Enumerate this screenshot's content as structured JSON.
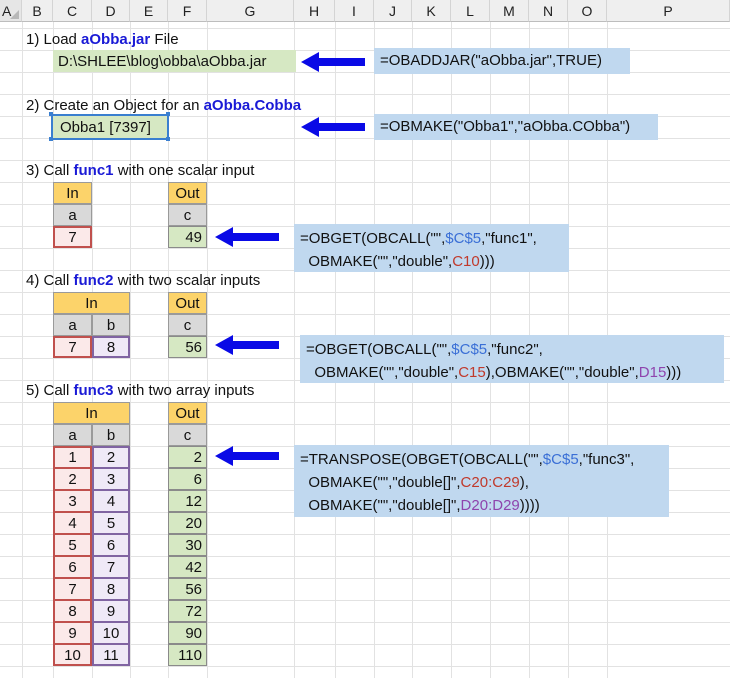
{
  "columns": [
    "A",
    "B",
    "C",
    "D",
    "E",
    "F",
    "G",
    "H",
    "I",
    "J",
    "K",
    "L",
    "M",
    "N",
    "O",
    "P"
  ],
  "colors": {
    "arrow": "#0a0ae6",
    "formula_bg": "#c0d8ef",
    "header_fill": "#fcd36a",
    "output_fill": "#d6e8c3"
  },
  "step1": {
    "label_pre": "1) Load ",
    "label_em": "aObba.jar",
    "label_post": " File",
    "path": "D:\\SHLEE\\blog\\obba\\aObba.jar",
    "formula": "=OBADDJAR(\"aObba.jar\",TRUE)"
  },
  "step2": {
    "label_pre": "2) Create an Object for an ",
    "label_em": "aObba.Cobba",
    "object": "Obba1 [7397]",
    "formula": "=OBMAKE(\"Obba1\",\"aObba.CObba\")"
  },
  "step3": {
    "label_pre": "3) Call ",
    "label_em": "func1",
    "label_post": " with one scalar input",
    "in_header": "In",
    "in_sub": "a",
    "in_value": "7",
    "out_header": "Out",
    "out_sub": "c",
    "out_value": "49",
    "formula_l1_a": "=OBGET(OBCALL(\"\",",
    "formula_l1_ref": "$C$5",
    "formula_l1_b": ",\"func1\",",
    "formula_l2_a": "OBMAKE(\"\",\"double\",",
    "formula_l2_ref": "C10",
    "formula_l2_b": ")))"
  },
  "step4": {
    "label_pre": "4) Call ",
    "label_em": "func2",
    "label_post": " with two scalar inputs",
    "in_header": "In",
    "in_sub_a": "a",
    "in_sub_b": "b",
    "in_a": "7",
    "in_b": "8",
    "out_header": "Out",
    "out_sub": "c",
    "out_value": "56",
    "formula_l1_a": "=OBGET(OBCALL(\"\",",
    "formula_l1_ref": "$C$5",
    "formula_l1_b": ",\"func2\",",
    "formula_l2_a": "OBMAKE(\"\",\"double\",",
    "formula_l2_ref1": "C15",
    "formula_l2_mid": "),OBMAKE(\"\",\"double\",",
    "formula_l2_ref2": "D15",
    "formula_l2_b": ")))"
  },
  "step5": {
    "label_pre": "5) Call ",
    "label_em": "func3",
    "label_post": " with two array inputs",
    "in_header": "In",
    "in_sub_a": "a",
    "in_sub_b": "b",
    "out_header": "Out",
    "out_sub": "c",
    "a_values": [
      "1",
      "2",
      "3",
      "4",
      "5",
      "6",
      "7",
      "8",
      "9",
      "10"
    ],
    "b_values": [
      "2",
      "3",
      "4",
      "5",
      "6",
      "7",
      "8",
      "9",
      "10",
      "11"
    ],
    "c_values": [
      "2",
      "6",
      "12",
      "20",
      "30",
      "42",
      "56",
      "72",
      "90",
      "110"
    ],
    "formula_l1_a": "=TRANSPOSE(OBGET(OBCALL(\"\",",
    "formula_l1_ref": "$C$5",
    "formula_l1_b": ",\"func3\",",
    "formula_l2_a": "OBMAKE(\"\",\"double[]\",",
    "formula_l2_ref": "C20:C29",
    "formula_l2_b": "),",
    "formula_l3_a": "OBMAKE(\"\",\"double[]\",",
    "formula_l3_ref": "D20:D29",
    "formula_l3_b": "))))"
  }
}
